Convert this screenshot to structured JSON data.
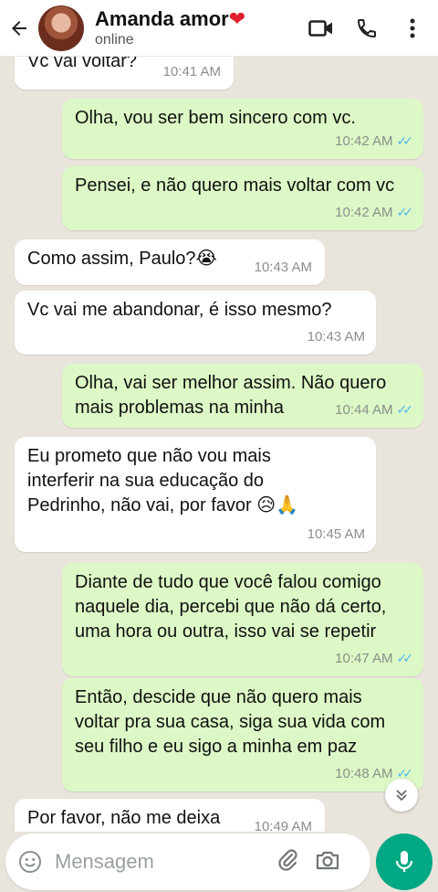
{
  "header": {
    "contact_name": "Amanda amor",
    "heart": "❤",
    "status": "online"
  },
  "messages": [
    {
      "dir": "in",
      "text": "Vc vai voltar?",
      "time": "10:41 AM",
      "read": false
    },
    {
      "dir": "out",
      "text": "Olha, vou ser bem sincero com vc.",
      "time": "10:42 AM",
      "read": true
    },
    {
      "dir": "out",
      "text": "Pensei, e não quero mais voltar com vc",
      "time": "10:42 AM",
      "read": true
    },
    {
      "dir": "in",
      "text": "Como assim, Paulo?😭",
      "time": "10:43 AM",
      "read": false
    },
    {
      "dir": "in",
      "text": "Vc vai me abandonar, é isso mesmo?",
      "time": "10:43 AM",
      "read": false
    },
    {
      "dir": "out",
      "text": "Olha, vai ser melhor assim. Não quero mais problemas na minha",
      "time": "10:44 AM",
      "read": true
    },
    {
      "dir": "in",
      "text": "Eu prometo que não vou mais interferir na sua educação do Pedrinho, não vai, por favor 😥🙏",
      "time": "10:45 AM",
      "read": false
    },
    {
      "dir": "out",
      "text": "Diante de tudo que você falou comigo naquele dia, percebi que não dá certo, uma hora ou outra, isso vai se repetir",
      "time": "10:47 AM",
      "read": true
    },
    {
      "dir": "out",
      "text": "Então, descide que não quero mais voltar pra sua casa, siga sua vida com seu filho e eu sigo a minha em paz",
      "time": "10:48 AM",
      "read": true
    },
    {
      "dir": "in",
      "text": "Por favor, não me deixa",
      "time": "10:49 AM",
      "read": false
    }
  ],
  "composer": {
    "placeholder": "Mensagem"
  },
  "colors": {
    "outgoing_bubble": "#dcf8c6",
    "incoming_bubble": "#ffffff",
    "accent": "#00a884",
    "read_ticks": "#4fb6ec"
  }
}
